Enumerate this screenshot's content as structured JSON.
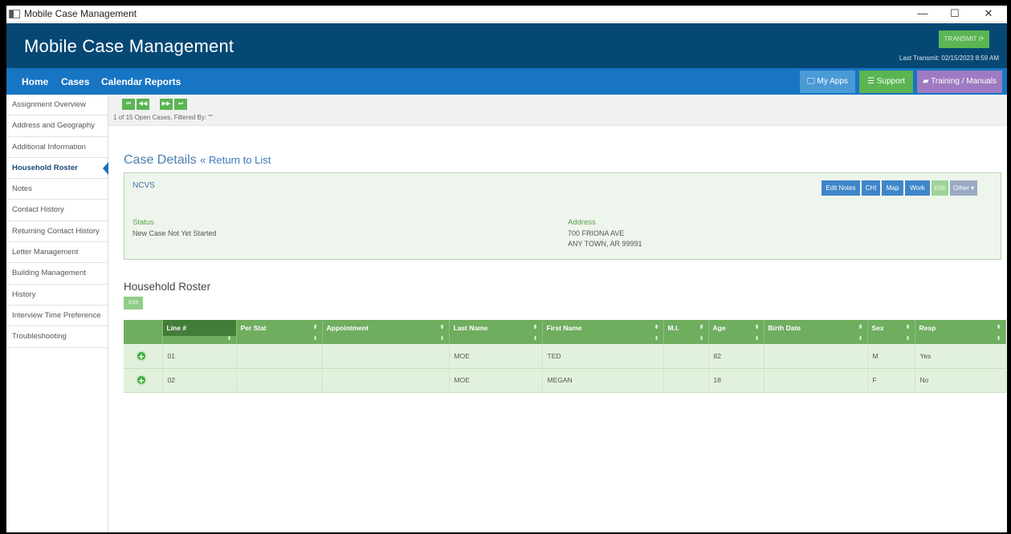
{
  "window": {
    "title": "Mobile Case Management",
    "controls": {
      "minimize": "—",
      "maximize": "☐",
      "close": "✕"
    }
  },
  "header": {
    "brand": "Mobile Case Management",
    "transmit_label": "TRANSMIT ⟳",
    "last_transmit": "Last Transmit: 02/15/2023 8:59 AM"
  },
  "nav": {
    "links": [
      "Home",
      "Cases",
      "Calendar",
      "Reports"
    ],
    "my_apps": "🖵 My Apps",
    "support": "☰ Support",
    "training": "▰ Training / Manuals"
  },
  "sidebar": {
    "items": [
      "Assignment Overview",
      "Address and Geography",
      "Additional Information",
      "Household Roster",
      "Notes",
      "Contact History",
      "Returning Contact History",
      "Letter Management",
      "Building Management",
      "History",
      "Interview Time Preference",
      "Troubleshooting"
    ],
    "active": "Household Roster"
  },
  "pager": {
    "buttons": [
      "⏮",
      "◀◀",
      "▶▶",
      "⏭"
    ],
    "status": "1 of 15  Open Cases, Filtered By: \"\""
  },
  "case": {
    "title": "Case Details",
    "return_link": "« Return to List",
    "program": "NCVS",
    "actions": [
      "Edit Notes",
      "CHI",
      "Map",
      "Work",
      "Edit",
      "Other ▾"
    ],
    "status_label": "Status",
    "status_value": "New Case Not Yet Started",
    "address_label": "Address",
    "address_line1": "700 FRIONA AVE",
    "address_line2": "ANY TOWN, AR 99991"
  },
  "roster": {
    "title": "Household Roster",
    "edit_label": "Edit",
    "columns": [
      "",
      "Line #",
      "Per Stat",
      "Appointment",
      "Last Name",
      "First Name",
      "M.I.",
      "Age",
      "Birth Date",
      "Sex",
      "Resp"
    ],
    "rows": [
      {
        "line": "01",
        "per_stat": "",
        "appointment": "",
        "last": "MOE",
        "first": "TED",
        "mi": "",
        "age": "82",
        "birth": "",
        "sex": "M",
        "resp": "Yes"
      },
      {
        "line": "02",
        "per_stat": "",
        "appointment": "",
        "last": "MOE",
        "first": "MEGAN",
        "mi": "",
        "age": "18",
        "birth": "",
        "sex": "F",
        "resp": "No"
      }
    ]
  },
  "colors": {
    "header_bg": "#064874",
    "nav_bg": "#1775c4",
    "accent_green": "#5ab552",
    "accent_purple": "#9e7ac2",
    "table_header": "#6fad5f"
  }
}
